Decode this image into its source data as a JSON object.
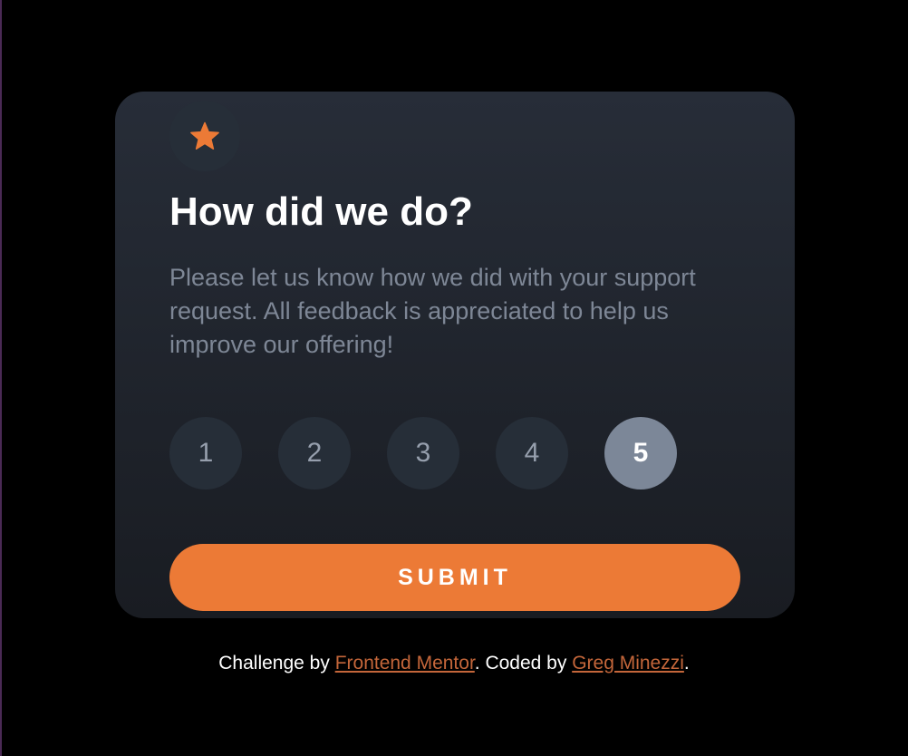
{
  "colors": {
    "background": "#000000",
    "card_top": "#272d38",
    "card_bottom": "#191c22",
    "accent_orange": "#ec7a36",
    "rating_bg": "#262e38",
    "rating_selected_bg": "#7c8798",
    "description_text": "#7e8796",
    "link_color": "#c4663a"
  },
  "card": {
    "icon": "star-icon",
    "title": "How did we do?",
    "description": "Please let us know how we did with your support request. All feedback is appreciated to help us improve our offering!",
    "ratings": [
      {
        "label": "1",
        "selected": false
      },
      {
        "label": "2",
        "selected": false
      },
      {
        "label": "3",
        "selected": false
      },
      {
        "label": "4",
        "selected": false
      },
      {
        "label": "5",
        "selected": true
      }
    ],
    "submit_label": "SUBMIT"
  },
  "attribution": {
    "prefix": "Challenge by ",
    "link1": "Frontend Mentor",
    "middle": ". Coded by ",
    "link2": "Greg Minezzi",
    "suffix": "."
  }
}
